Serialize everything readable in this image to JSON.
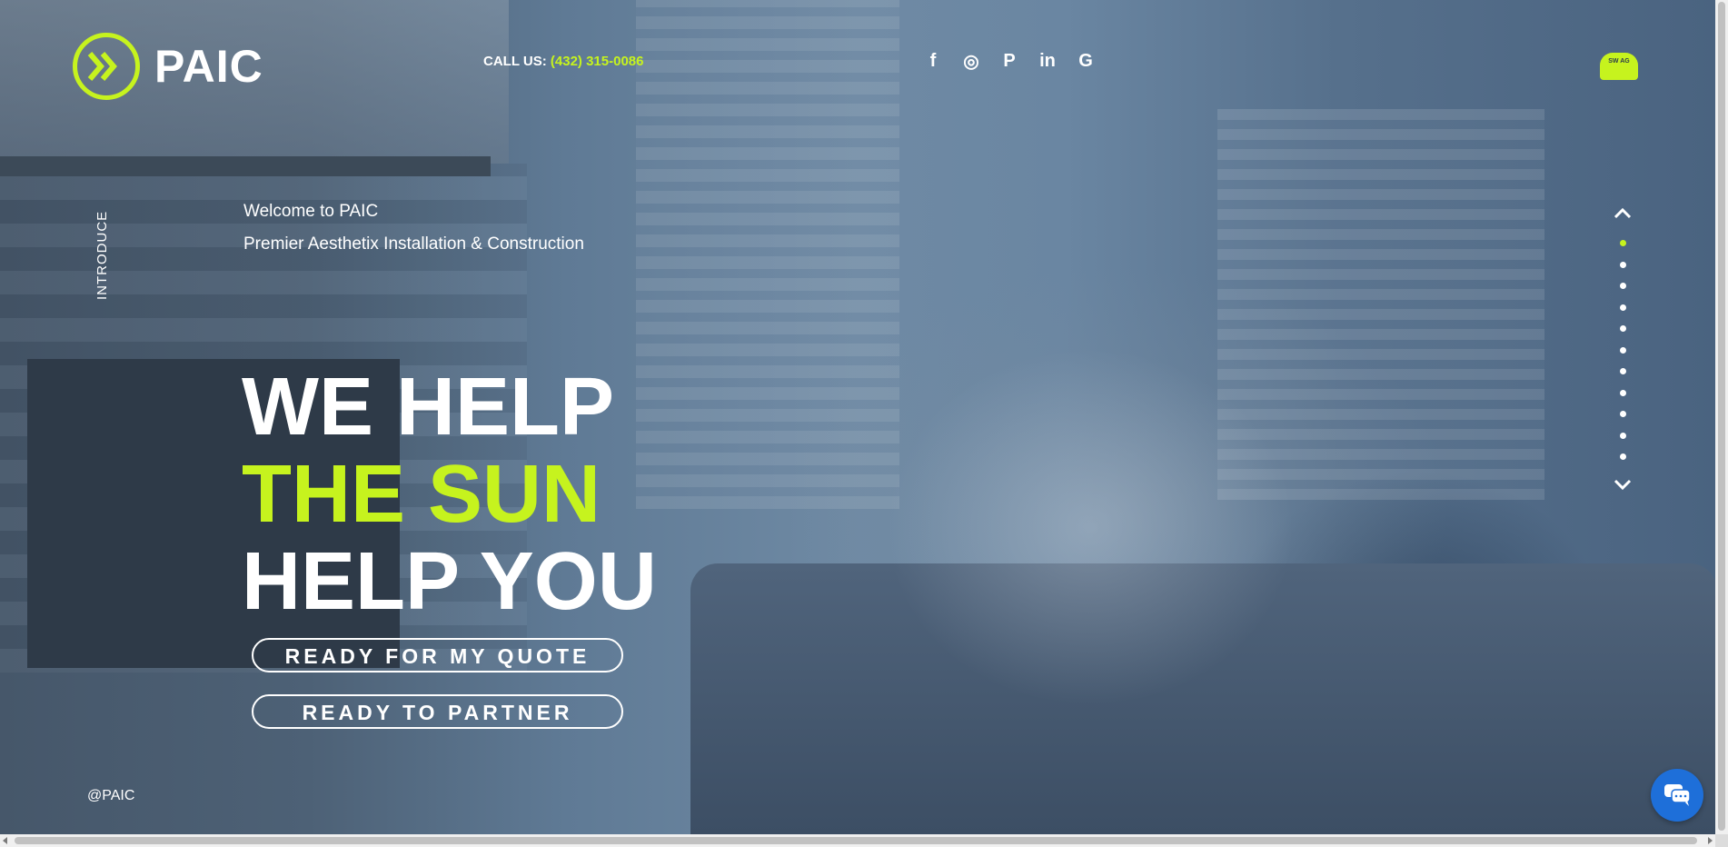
{
  "header": {
    "logo_text": "PAIC",
    "call_label": "CALL US:",
    "phone": "(432) 315-0086",
    "socials": [
      {
        "icon": "facebook-icon",
        "glyph": "f"
      },
      {
        "icon": "instagram-icon",
        "glyph": "◎"
      },
      {
        "icon": "pinterest-icon",
        "glyph": "P"
      },
      {
        "icon": "linkedin-icon",
        "glyph": "in"
      },
      {
        "icon": "google-icon",
        "glyph": "G"
      }
    ],
    "swag_text": "SW AG"
  },
  "intro": {
    "rail_label": "INTRODUCE",
    "welcome": "Welcome to PAIC",
    "subtitle": "Premier Aesthetix Installation & Construction"
  },
  "headline": {
    "line1": "WE HELP",
    "line2": "THE SUN",
    "line3": "HELP YOU"
  },
  "buttons": {
    "quote": "READY FOR MY QUOTE",
    "partner": "READY TO PARTNER"
  },
  "footer": {
    "copyright": "@PAIC"
  },
  "pager": {
    "slide_count": 11,
    "active_index": 0
  },
  "colors": {
    "accent": "#c6f31e",
    "overlay": "#3e5670",
    "chat": "#1e6fd9"
  }
}
